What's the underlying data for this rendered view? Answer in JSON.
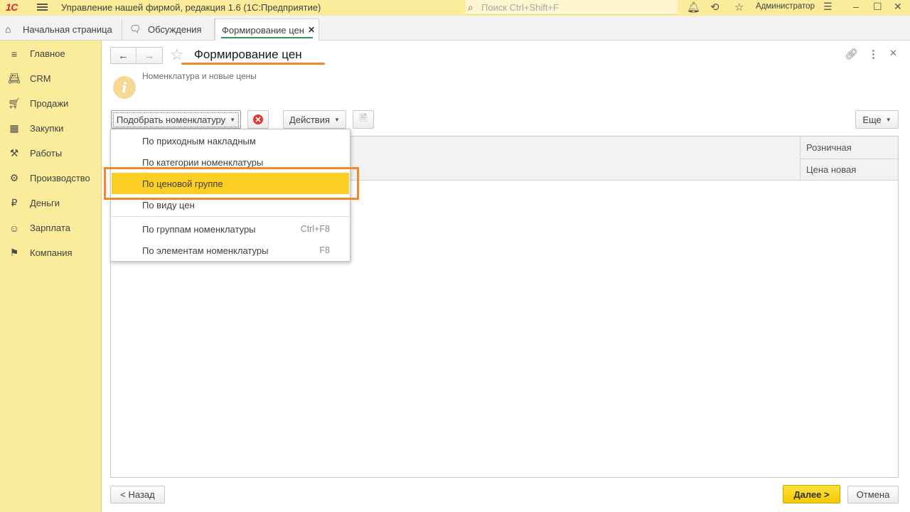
{
  "titlebar": {
    "logo": "1С",
    "app_title": "Управление нашей фирмой, редакция 1.6  (1С:Предприятие)",
    "search_placeholder": "Поиск Ctrl+Shift+F",
    "user": "Администратор"
  },
  "tabs": [
    {
      "label": "Начальная страница"
    },
    {
      "label": "Обсуждения"
    },
    {
      "label": "Формирование цен"
    }
  ],
  "sidebar": {
    "items": [
      {
        "label": "Главное",
        "icon": "menu-lines-icon"
      },
      {
        "label": "CRM",
        "icon": "contact-card-icon"
      },
      {
        "label": "Продажи",
        "icon": "basket-icon"
      },
      {
        "label": "Закупки",
        "icon": "shelves-icon"
      },
      {
        "label": "Работы",
        "icon": "tools-icon"
      },
      {
        "label": "Производство",
        "icon": "factory-icon"
      },
      {
        "label": "Деньги",
        "icon": "ruble-icon"
      },
      {
        "label": "Зарплата",
        "icon": "person-icon"
      },
      {
        "label": "Компания",
        "icon": "flag-icon"
      }
    ]
  },
  "page": {
    "title": "Формирование цен",
    "info": "Номенклатура и новые цены"
  },
  "toolbar": {
    "pick_label": "Подобрать номенклатуру",
    "actions_label": "Действия",
    "more_label": "Еще"
  },
  "table": {
    "col_top": "Розничная",
    "col_bottom": "Цена новая"
  },
  "dropdown": {
    "items": [
      {
        "label": "По приходным накладным",
        "shortcut": ""
      },
      {
        "label": "По категории номенклатуры",
        "shortcut": ""
      },
      {
        "label": "По ценовой группе",
        "shortcut": "",
        "highlighted": true
      },
      {
        "label": "По виду цен",
        "shortcut": ""
      },
      {
        "label": "По группам номенклатуры",
        "shortcut": "Ctrl+F8"
      },
      {
        "label": "По элементам номенклатуры",
        "shortcut": "F8"
      }
    ]
  },
  "footer": {
    "back_label": "< Назад",
    "next_label": "Далее >",
    "cancel_label": "Отмена"
  },
  "colors": {
    "sidebar_bg": "#fbec9c",
    "highlight": "#fbce24",
    "annotation": "#ef8a2b",
    "primary_button": "#f5c800"
  }
}
